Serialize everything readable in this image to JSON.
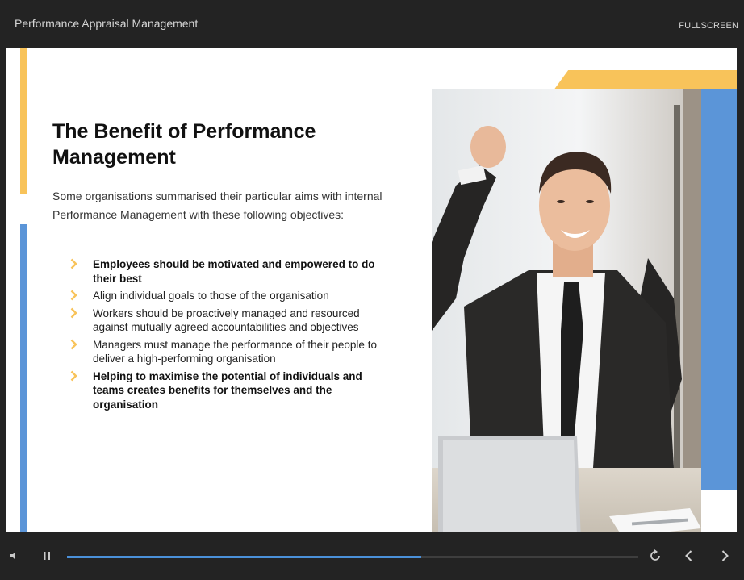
{
  "window": {
    "title": "Performance Appraisal Management",
    "fullscreen_label": "FULLSCREEN"
  },
  "slide": {
    "title": "The Benefit of Performance Management",
    "intro": "Some organisations summarised their particular aims with internal Performance Management with these following objectives:",
    "bullets": [
      {
        "text": "Employees should be motivated and empowered to do their best",
        "bold": true
      },
      {
        "text": "Align individual goals to those of the organisation",
        "bold": false
      },
      {
        "text": "Workers should be proactively managed and resourced against mutually agreed accountabilities and objectives",
        "bold": false
      },
      {
        "text": "Managers must manage the performance of their people to deliver a high-performing organisation",
        "bold": false
      },
      {
        "text": "Helping to maximise the potential of individuals and teams creates benefits for themselves and the organisation",
        "bold": true
      }
    ],
    "colors": {
      "accent_yellow": "#f8c35a",
      "accent_blue": "#5b95d8",
      "bullet_chevron": "#f8c35a"
    },
    "photo": "celebrating-businessman-at-laptop"
  },
  "player": {
    "progress": 0.62,
    "icons": {
      "volume": "volume-icon",
      "pause": "pause-icon",
      "replay": "replay-icon",
      "previous": "chevron-left-icon",
      "next": "chevron-right-icon"
    },
    "colors": {
      "progress_fill": "#4a90d9",
      "progress_track": "#3e3e3e"
    }
  }
}
